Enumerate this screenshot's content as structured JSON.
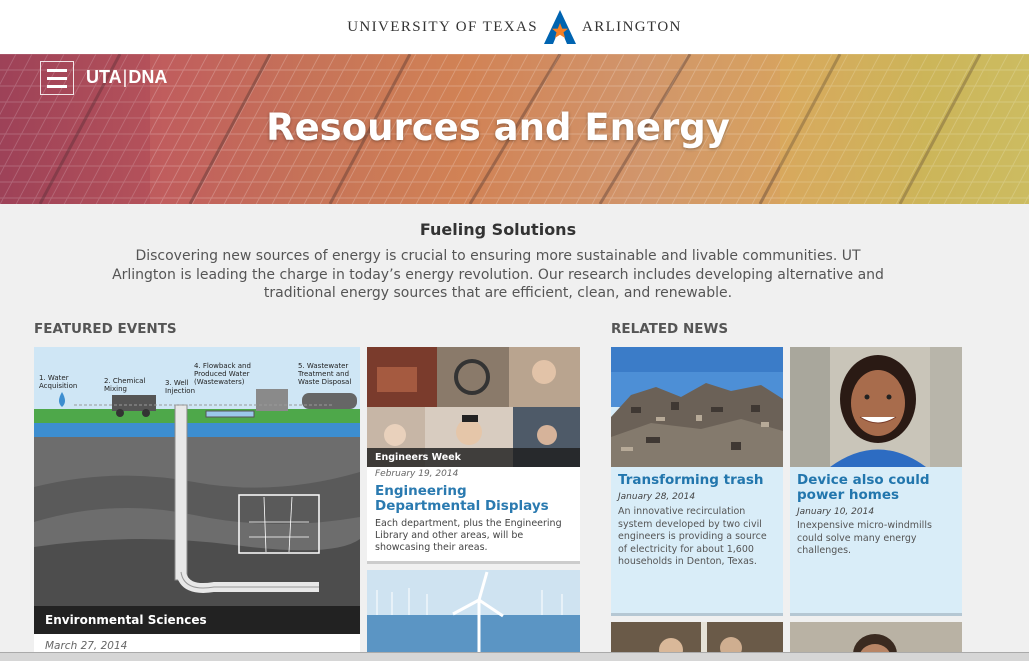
{
  "header": {
    "logo_left": "UNIVERSITY OF TEXAS",
    "logo_right": "ARLINGTON"
  },
  "hero": {
    "brand_left": "UTA",
    "brand_sep": "|",
    "brand_right": "DNA",
    "title": "Resources and Energy"
  },
  "intro": {
    "title": "Fueling Solutions",
    "text": "Discovering new sources of energy is crucial to ensuring more sustainable and livable communities. UT Arlington is leading the charge in today’s energy revolution. Our research includes developing alternative and traditional energy sources that are efficient, clean, and renewable."
  },
  "featured_events": {
    "title": "FEATURED EVENTS",
    "main": {
      "diagram_labels": [
        "1. Water Acquisition",
        "2. Chemical Mixing",
        "3. Well Injection",
        "4. Flowback and Produced Water (Wastewaters)",
        "5. Wastewater Treatment and Waste Disposal"
      ],
      "caption": "Environmental Sciences",
      "date": "March 27, 2014"
    },
    "second": {
      "tag": "Engineers Week",
      "date": "February 19, 2014",
      "headline": "Engineering Departmental Displays",
      "body": "Each department, plus the Engineering Library and other areas, will be showcasing their areas."
    }
  },
  "related_news": {
    "title": "RELATED NEWS",
    "items": [
      {
        "headline": "Transforming trash",
        "date": "January 28, 2014",
        "body": "An innovative recirculation system developed by two civil engineers is providing a source of electricity for about 1,600 households in Denton, Texas."
      },
      {
        "headline": "Device also could power homes",
        "date": "January 10, 2014",
        "body": "Inexpensive micro-windmills could solve many energy challenges."
      }
    ]
  },
  "colors": {
    "link_blue": "#2a7ab0",
    "uta_blue": "#0064b1",
    "uta_orange": "#f58025",
    "news_bg": "#d9edf8"
  },
  "icons": {
    "menu": "hamburger-icon",
    "logo_mark": "star-a-logo-icon"
  }
}
